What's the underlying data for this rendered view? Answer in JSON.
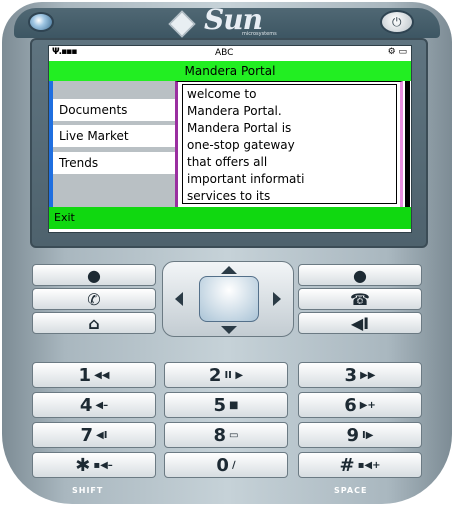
{
  "device": {
    "brand": "Sun",
    "brand_sub": "microsystems"
  },
  "status_bar": {
    "signal": "Ψ.▪▪▪",
    "input_mode": "ABC",
    "icons": "⚙ ▭"
  },
  "screen": {
    "title": "Mandera Portal",
    "menu_items": [
      {
        "label": ""
      },
      {
        "label": "Documents"
      },
      {
        "label": "Live Market"
      },
      {
        "label": "Trends"
      },
      {
        "label": ""
      }
    ],
    "message": "welcome to\nMandera Portal.\nMandera Portal is\none-stop gateway\nthat offers all\nimportant informati\nservices to its\nlivestock keeping",
    "command": "Exit"
  },
  "keypad": {
    "rows": [
      [
        {
          "num": "1",
          "sub": "◀◀"
        },
        {
          "num": "2",
          "sub": "II ▶"
        },
        {
          "num": "3",
          "sub": "▶▶"
        }
      ],
      [
        {
          "num": "4",
          "sub": "◀–"
        },
        {
          "num": "5",
          "sub": "■"
        },
        {
          "num": "6",
          "sub": "▶+"
        }
      ],
      [
        {
          "num": "7",
          "sub": "◀I"
        },
        {
          "num": "8",
          "sub": "▭"
        },
        {
          "num": "9",
          "sub": "I▶"
        }
      ],
      [
        {
          "num": "✱",
          "sub": "▪◀–"
        },
        {
          "num": "0",
          "sub": "∕"
        },
        {
          "num": "#",
          "sub": "▪◀+"
        }
      ]
    ],
    "shift_label": "SHIFT",
    "space_label": "SPACE"
  },
  "colors": {
    "title_bar": "#22ee22",
    "command_bar": "#10d810",
    "menu_stripe": "#1f6fe0"
  }
}
